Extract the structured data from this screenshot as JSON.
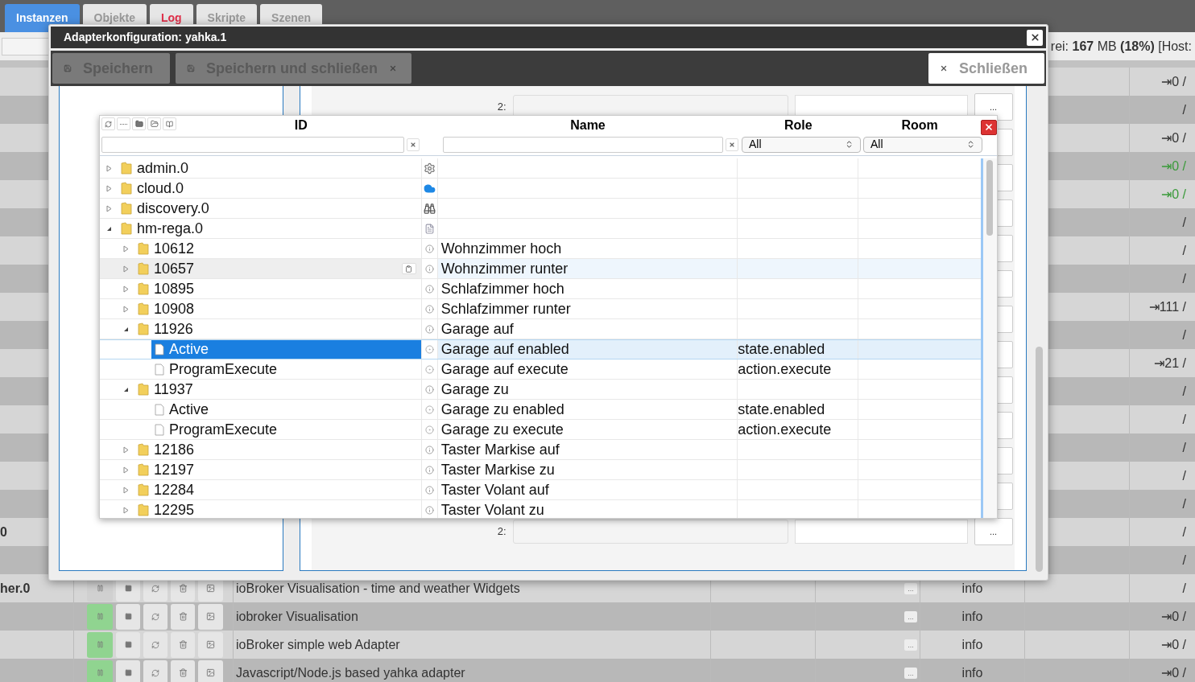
{
  "tabs": [
    {
      "label": "Instanzen",
      "selected": true,
      "alert": false
    },
    {
      "label": "Objekte",
      "selected": false,
      "alert": false
    },
    {
      "label": "Log",
      "selected": false,
      "alert": true
    },
    {
      "label": "Skripte",
      "selected": false,
      "alert": false
    },
    {
      "label": "Szenen",
      "selected": false,
      "alert": false
    }
  ],
  "memory_status": "rei: **167** MB **(18%)** [Host:",
  "instances": [
    {
      "value": "⇥0 /",
      "color": "#333333"
    },
    {
      "value": "/",
      "color": "#333333"
    },
    {
      "value": "⇥0 /",
      "color": "#333333"
    },
    {
      "value": "⇥0 /",
      "color": "#3a9a3a"
    },
    {
      "value": "⇥0 /",
      "color": "#3a9a3a"
    },
    {
      "value": "/",
      "color": "#333333"
    },
    {
      "value": "/",
      "color": "#333333"
    },
    {
      "value": "/",
      "color": "#333333"
    },
    {
      "value": "⇥111 /",
      "color": "#333333"
    },
    {
      "value": "/",
      "color": "#333333"
    },
    {
      "value": "⇥21 /",
      "color": "#333333"
    },
    {
      "value": "/",
      "color": "#333333"
    },
    {
      "value": "/",
      "color": "#333333"
    },
    {
      "value": "/",
      "color": "#333333"
    },
    {
      "value": "/",
      "color": "#333333"
    },
    {
      "value": "/",
      "color": "#333333"
    },
    {
      "name": "0",
      "value": "/",
      "color": "#333333"
    },
    {
      "value": "/",
      "color": "#333333"
    },
    {
      "name": "her.0",
      "running": false,
      "description": "ioBroker Visualisation - time and weather Widgets",
      "more": "...",
      "log_level": "info",
      "value": "/",
      "color": "#333333"
    },
    {
      "running": true,
      "description": "iobroker Visualisation",
      "more": "...",
      "log_level": "info",
      "value": "⇥0 /",
      "color": "#333333"
    },
    {
      "running": true,
      "description": "ioBroker simple web Adapter",
      "more": "...",
      "log_level": "info",
      "value": "⇥0 /",
      "color": "#333333"
    },
    {
      "running": true,
      "description": "Javascript/Node.js based yahka adapter",
      "more": "...",
      "log_level": "info",
      "value": "⇥0 /",
      "color": "#333333"
    }
  ],
  "dialog": {
    "title": "Adapterkonfiguration: yahka.1",
    "save": "Speichern",
    "save_close": "Speichern und schließen",
    "close": "Schließen",
    "fields": [
      {
        "label": "2:",
        "button": "..."
      },
      {
        "label": "2:",
        "button": "..."
      }
    ]
  },
  "object_browser": {
    "columns": [
      "ID",
      "Name",
      "Role",
      "Room"
    ],
    "role_filter": "All",
    "room_filter": "All",
    "tree": [
      {
        "id": "admin.0",
        "kind": "adapter",
        "expanded": false,
        "selected": false,
        "hovered": false
      },
      {
        "id": "cloud.0",
        "kind": "adapter",
        "expanded": false,
        "selected": false,
        "hovered": false
      },
      {
        "id": "discovery.0",
        "kind": "adapter",
        "expanded": false,
        "selected": false,
        "hovered": false
      },
      {
        "id": "hm-rega.0",
        "kind": "adapter",
        "expanded": true,
        "selected": false,
        "hovered": false,
        "children": [
          {
            "id": "10612",
            "kind": "channel",
            "name": "Wohnzimmer hoch",
            "expanded": false,
            "selected": false,
            "hovered": false
          },
          {
            "id": "10657",
            "kind": "channel",
            "name": "Wohnzimmer runter",
            "expanded": false,
            "selected": false,
            "hovered": true
          },
          {
            "id": "10895",
            "kind": "channel",
            "name": "Schlafzimmer hoch",
            "expanded": false,
            "selected": false,
            "hovered": false
          },
          {
            "id": "10908",
            "kind": "channel",
            "name": "Schlafzimmer runter",
            "expanded": false,
            "selected": false,
            "hovered": false
          },
          {
            "id": "11926",
            "kind": "channel",
            "name": "Garage auf",
            "expanded": true,
            "selected": false,
            "hovered": false,
            "children": [
              {
                "id": "Active",
                "kind": "state",
                "name": "Garage auf enabled",
                "role": "state.enabled",
                "selected": true,
                "hovered": false
              },
              {
                "id": "ProgramExecute",
                "kind": "state",
                "name": "Garage auf execute",
                "role": "action.execute",
                "selected": false,
                "hovered": false
              }
            ]
          },
          {
            "id": "11937",
            "kind": "channel",
            "name": "Garage zu",
            "expanded": true,
            "selected": false,
            "hovered": false,
            "children": [
              {
                "id": "Active",
                "kind": "state",
                "name": "Garage zu enabled",
                "role": "state.enabled",
                "selected": false,
                "hovered": false
              },
              {
                "id": "ProgramExecute",
                "kind": "state",
                "name": "Garage zu execute",
                "role": "action.execute",
                "selected": false,
                "hovered": false
              }
            ]
          },
          {
            "id": "12186",
            "kind": "channel",
            "name": "Taster Markise auf",
            "expanded": false,
            "selected": false,
            "hovered": false
          },
          {
            "id": "12197",
            "kind": "channel",
            "name": "Taster Markise zu",
            "expanded": false,
            "selected": false,
            "hovered": false
          },
          {
            "id": "12284",
            "kind": "channel",
            "name": "Taster Volant auf",
            "expanded": false,
            "selected": false,
            "hovered": false
          },
          {
            "id": "12295",
            "kind": "channel",
            "name": "Taster Volant zu",
            "expanded": false,
            "selected": false,
            "hovered": false
          }
        ]
      }
    ]
  }
}
